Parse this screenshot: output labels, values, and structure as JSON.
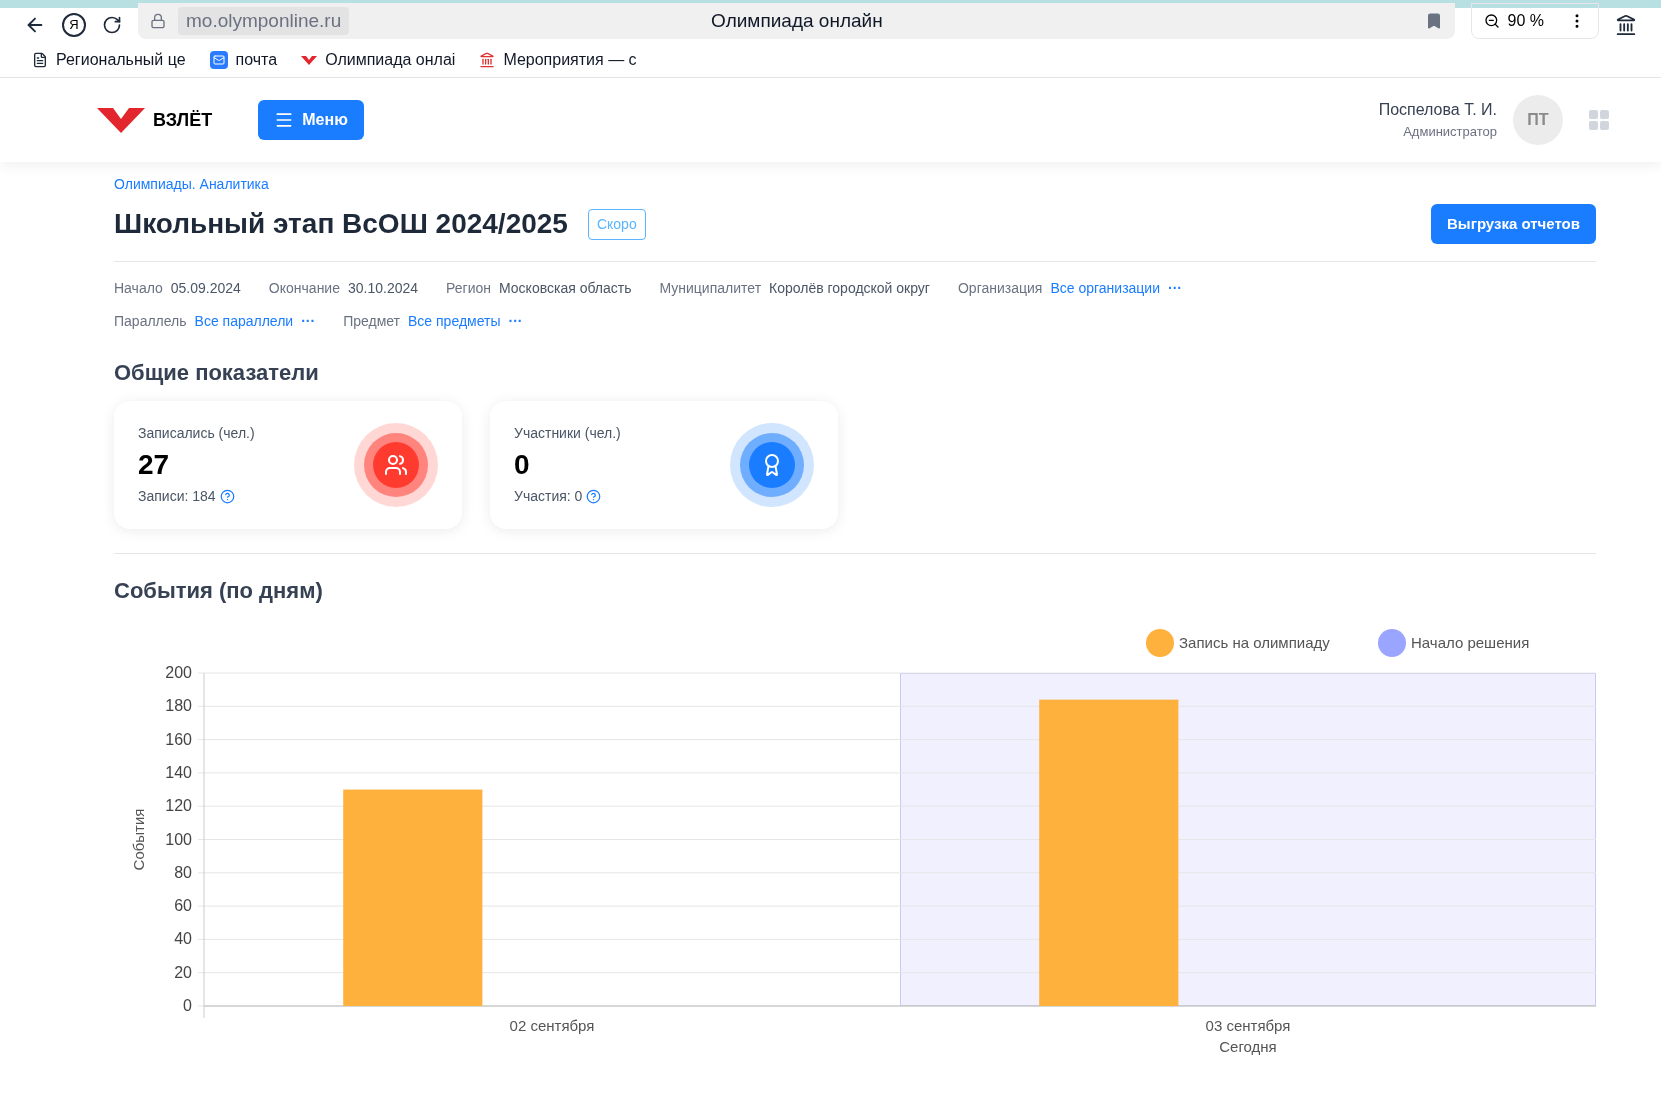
{
  "browser": {
    "engine_logo": "Я",
    "address": "mo.olymponline.ru",
    "title": "Олимпиада онлайн",
    "zoom": "90 %",
    "bookmarks": [
      {
        "label": "Региональный це",
        "kind": "page"
      },
      {
        "label": "почта",
        "kind": "mail"
      },
      {
        "label": "Олимпиада онлаі",
        "kind": "logo"
      },
      {
        "label": "Мероприятия — с",
        "kind": "emblem"
      }
    ]
  },
  "header": {
    "logo": "ВЗЛЁТ",
    "menu_button": "Меню",
    "user_name": "Поспелова Т. И.",
    "user_role": "Администратор",
    "avatar_initials": "ПТ"
  },
  "breadcrumb": "Олимпиады. Аналитика",
  "title": "Школьный этап ВсОШ 2024/2025",
  "status_badge": "Скоро",
  "export_button": "Выгрузка отчетов",
  "filters": [
    [
      {
        "label": "Начало",
        "value": "05.09.2024",
        "link": false
      },
      {
        "label": "Окончание",
        "value": "30.10.2024",
        "link": false
      },
      {
        "label": "Регион",
        "value": "Московская область",
        "link": false
      },
      {
        "label": "Муниципалитет",
        "value": "Королёв городской округ",
        "link": false
      },
      {
        "label": "Организация",
        "value": "Все организации",
        "link": true,
        "more": "···"
      }
    ],
    [
      {
        "label": "Параллель",
        "value": "Все параллели",
        "link": true,
        "more": "···"
      },
      {
        "label": "Предмет",
        "value": "Все предметы",
        "link": true,
        "more": "···"
      }
    ]
  ],
  "summary": {
    "heading": "Общие показатели",
    "cards": [
      {
        "label": "Записались (чел.)",
        "value": "27",
        "note": "Записи: 184",
        "kind": "people",
        "color": "#ff3b30"
      },
      {
        "label": "Участники (чел.)",
        "value": "0",
        "note": "Участия: 0",
        "kind": "award",
        "color": "#1a7cff"
      }
    ]
  },
  "events": {
    "heading": "События (по дням)",
    "chart_data": {
      "type": "bar",
      "ylabel": "События",
      "categories": [
        "02 сентября",
        "03 сентября"
      ],
      "series": [
        {
          "name": "Запись на олимпиаду",
          "color": "#ffb13d",
          "values": [
            130,
            184
          ]
        },
        {
          "name": "Начало решения",
          "color": "#9aa5ff",
          "values": [
            0,
            0
          ]
        }
      ],
      "ylim": [
        0,
        200
      ],
      "yticks": [
        0,
        20,
        40,
        60,
        80,
        100,
        120,
        140,
        160,
        180,
        200
      ],
      "grid": true,
      "annotations": [
        "Сегодня"
      ]
    }
  }
}
